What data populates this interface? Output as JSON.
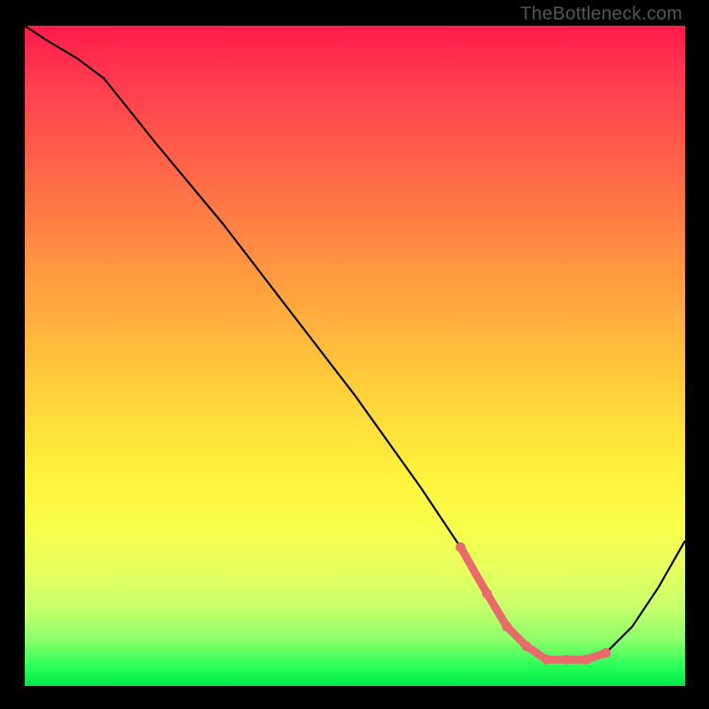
{
  "watermark": "TheBottleneck.com",
  "chart_data": {
    "type": "line",
    "title": "",
    "xlabel": "",
    "ylabel": "",
    "xlim": [
      0,
      100
    ],
    "ylim": [
      0,
      100
    ],
    "grid": false,
    "series": [
      {
        "name": "bottleneck-curve",
        "x": [
          0,
          3,
          8,
          12,
          20,
          30,
          40,
          50,
          60,
          66,
          70,
          73,
          76,
          79,
          82,
          85,
          88,
          92,
          96,
          100
        ],
        "y": [
          100,
          98,
          95,
          92,
          82,
          70,
          57,
          44,
          30,
          21,
          14,
          9,
          6,
          4,
          4,
          4,
          5,
          9,
          15,
          22
        ]
      },
      {
        "name": "highlight-range",
        "x": [
          66,
          70,
          73,
          76,
          79,
          82,
          85,
          88
        ],
        "y": [
          21,
          14,
          9,
          6,
          4,
          4,
          4,
          5
        ]
      }
    ]
  }
}
